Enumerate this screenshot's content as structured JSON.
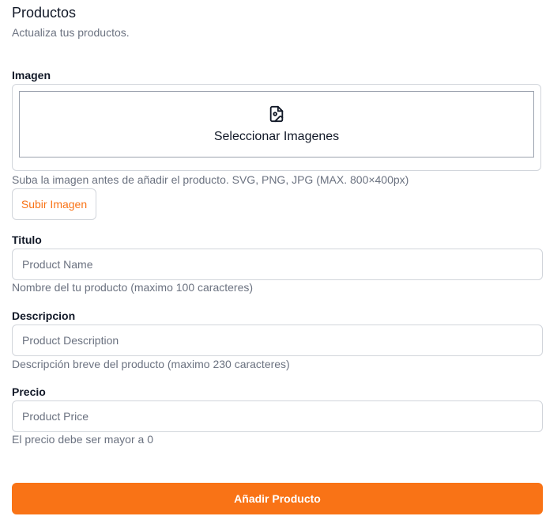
{
  "header": {
    "title": "Productos",
    "subtitle": "Actualiza tus productos."
  },
  "image_section": {
    "label": "Imagen",
    "dropzone_text": "Seleccionar Imagenes",
    "dropzone_icon": "file-image-icon",
    "hint": "Suba la imagen antes de añadir el producto. SVG, PNG, JPG (MAX. 800×400px)",
    "upload_button": "Subir Imagen"
  },
  "title_field": {
    "label": "Titulo",
    "placeholder": "Product Name",
    "value": "",
    "hint": "Nombre del tu producto (maximo 100 caracteres)"
  },
  "description_field": {
    "label": "Descripcion",
    "placeholder": "Product Description",
    "value": "",
    "hint": "Descripción breve del producto (maximo 230 caracteres)"
  },
  "price_field": {
    "label": "Precio",
    "placeholder": "Product Price",
    "value": "",
    "hint": "El precio debe ser mayor a 0"
  },
  "submit_button": "Añadir Producto",
  "colors": {
    "accent": "#f97316",
    "border": "#d1d5db",
    "muted_text": "#6b7280",
    "text": "#111827"
  }
}
